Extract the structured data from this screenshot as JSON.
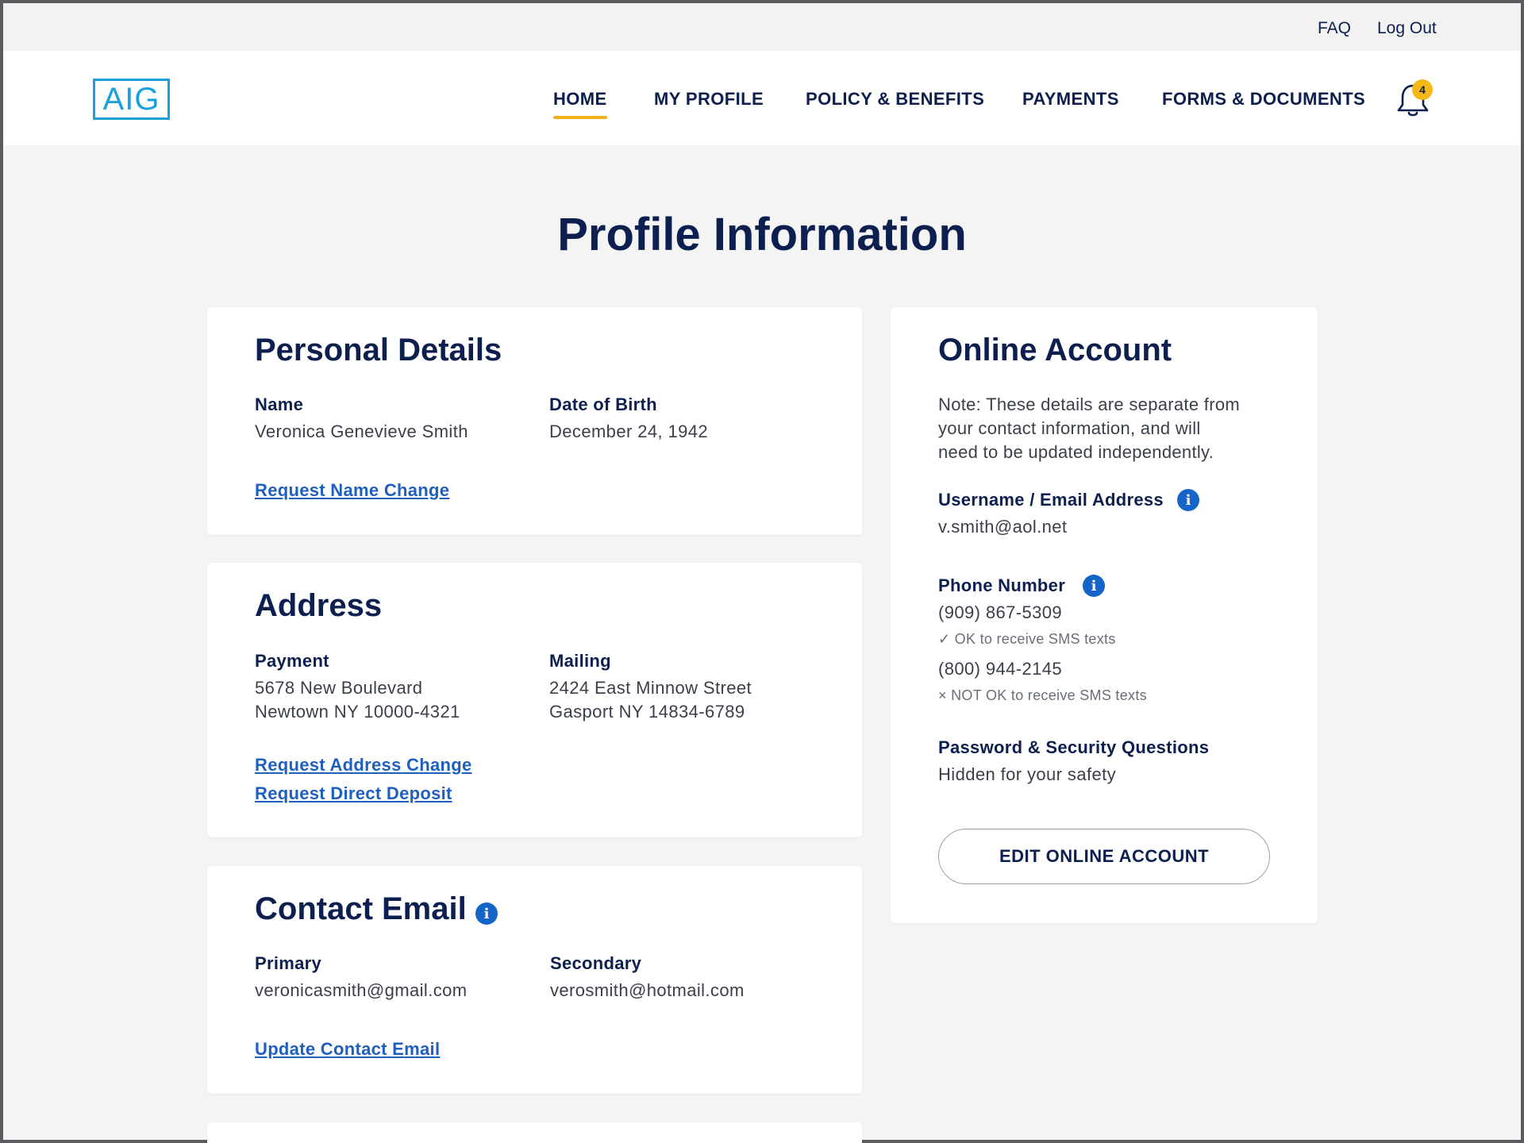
{
  "utility": {
    "faq": "FAQ",
    "logout": "Log Out"
  },
  "logo": {
    "text": "AIG"
  },
  "nav": {
    "home": "HOME",
    "my_profile": "MY PROFILE",
    "policy": "POLICY & BENEFITS",
    "payments": "PAYMENTS",
    "forms": "FORMS & DOCUMENTS",
    "notification_count": "4",
    "bell_icon": "bell-icon"
  },
  "page": {
    "title": "Profile Information"
  },
  "personal": {
    "title": "Personal Details",
    "name_label": "Name",
    "name_value": "Veronica Genevieve Smith",
    "dob_label": "Date of Birth",
    "dob_value": "December 24, 1942",
    "link": "Request Name Change"
  },
  "address": {
    "title": "Address",
    "payment_label": "Payment",
    "payment_line1": "5678 New Boulevard",
    "payment_line2": "Newtown NY 10000-4321",
    "mailing_label": "Mailing",
    "mailing_line1": "2424 East Minnow Street",
    "mailing_line2": "Gasport NY 14834-6789",
    "link_address": "Request Address Change",
    "link_deposit": "Request Direct Deposit"
  },
  "contact_email": {
    "title": "Contact Email",
    "primary_label": "Primary",
    "primary_value": "veronicasmith@gmail.com",
    "secondary_label": "Secondary",
    "secondary_value": "verosmith@hotmail.com",
    "link": "Update Contact Email"
  },
  "online_account": {
    "title": "Online Account",
    "note_line1": "Note: These details are separate from",
    "note_line2": "your contact information, and will",
    "note_line3": "need to be updated independently.",
    "username_label": "Username / Email Address",
    "username_value": "v.smith@aol.net",
    "phone_label": "Phone Number",
    "phone1": "(909) 867-5309",
    "phone1_sms": "✓ OK to receive SMS texts",
    "phone2": "(800) 944-2145",
    "phone2_sms": "× NOT OK to receive SMS texts",
    "password_label": "Password & Security Questions",
    "password_value": "Hidden for your safety",
    "button": "EDIT ONLINE ACCOUNT"
  },
  "colors": {
    "navy": "#0c1f4f",
    "link_blue": "#1f5fbf",
    "info_blue": "#1565c8",
    "accent_yellow": "#f2b01e",
    "logo_blue": "#1aa0dc"
  }
}
